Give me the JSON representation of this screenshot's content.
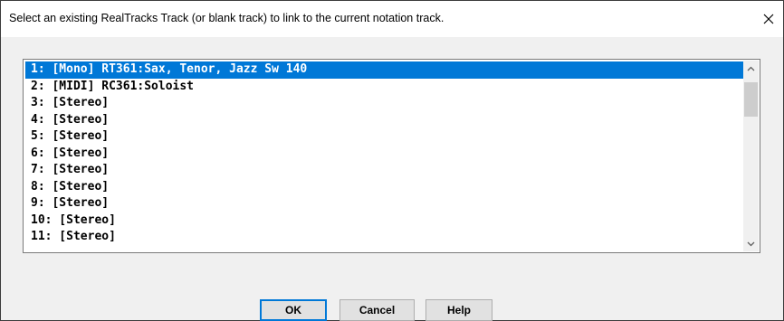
{
  "dialog": {
    "title": "Select an existing RealTracks Track (or blank track) to link to the current notation track.",
    "close_icon": "close-icon"
  },
  "list": {
    "selected_index": 0,
    "items": [
      "1: [Mono] RT361:Sax, Tenor, Jazz Sw 140",
      "2: [MIDI] RC361:Soloist",
      "3: [Stereo]",
      "4: [Stereo]",
      "5: [Stereo]",
      "6: [Stereo]",
      "7: [Stereo]",
      "8: [Stereo]",
      "9: [Stereo]",
      "10: [Stereo]",
      "11: [Stereo]"
    ]
  },
  "scrollbar": {
    "up_icon": "chevron-up-icon",
    "down_icon": "chevron-down-icon"
  },
  "buttons": {
    "ok": "OK",
    "cancel": "Cancel",
    "help": "Help"
  },
  "colors": {
    "selection": "#0078d7",
    "default_button_border": "#0078d7"
  }
}
